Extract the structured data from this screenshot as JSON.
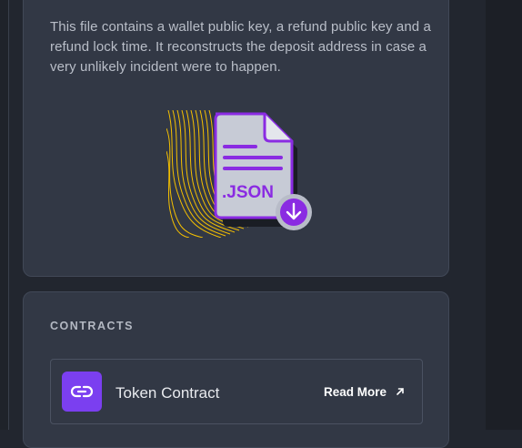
{
  "file_card": {
    "description": "This file contains a wallet public key, a refund public key and a refund lock time. It reconstructs the deposit address in case a very unlikely incident were to happen.",
    "file_label": ".JSON"
  },
  "contracts": {
    "title": "CONTRACTS",
    "items": [
      {
        "name": "Token Contract",
        "link_label": "Read More"
      }
    ]
  },
  "colors": {
    "accent_purple": "#7b3ff0",
    "card_bg": "#323845",
    "page_bg": "#22262f",
    "illus_yellow": "#f5c000"
  }
}
